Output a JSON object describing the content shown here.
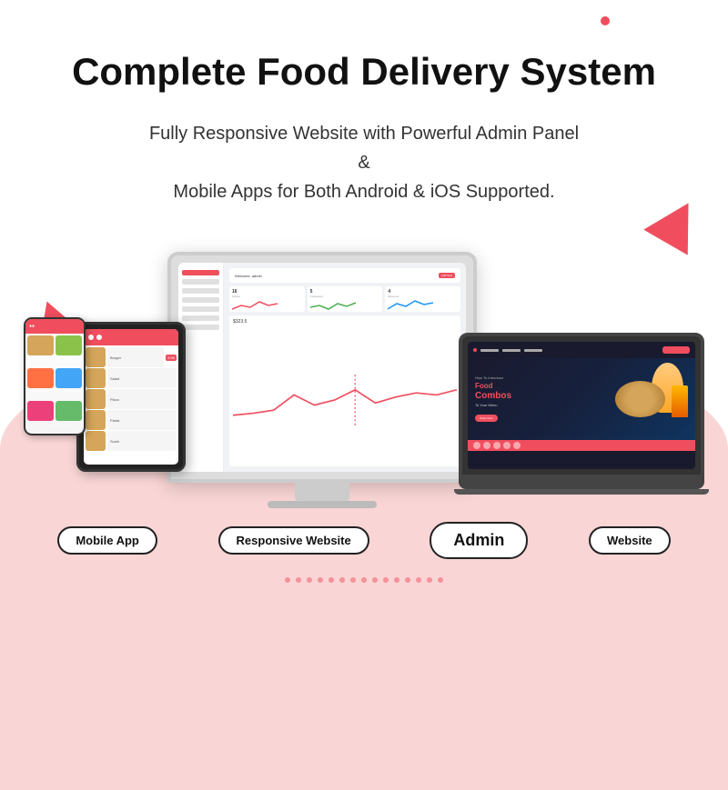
{
  "header": {
    "main_title": "Complete Food Delivery System",
    "subtitle_line1": "Fully Responsive Website with Powerful Admin Panel",
    "subtitle_ampersand": "&",
    "subtitle_line2": "Mobile Apps for Both Android & iOS Supported."
  },
  "devices": {
    "phone_label": "Mobile App",
    "tablet_label": "Responsive Website",
    "monitor_label": "Admin",
    "laptop_label": "Website"
  },
  "website_hero": {
    "intro": "How To Introduce",
    "title_food": "Food",
    "title_combos": "Combos",
    "subtitle": "To Your Menu",
    "cta": "Order Now"
  },
  "admin": {
    "welcome": "Welcome, admin",
    "btn_label": "Add New"
  },
  "decorations": {
    "accent_color": "#f04e5e",
    "blob_color": "#f9d5d5"
  }
}
